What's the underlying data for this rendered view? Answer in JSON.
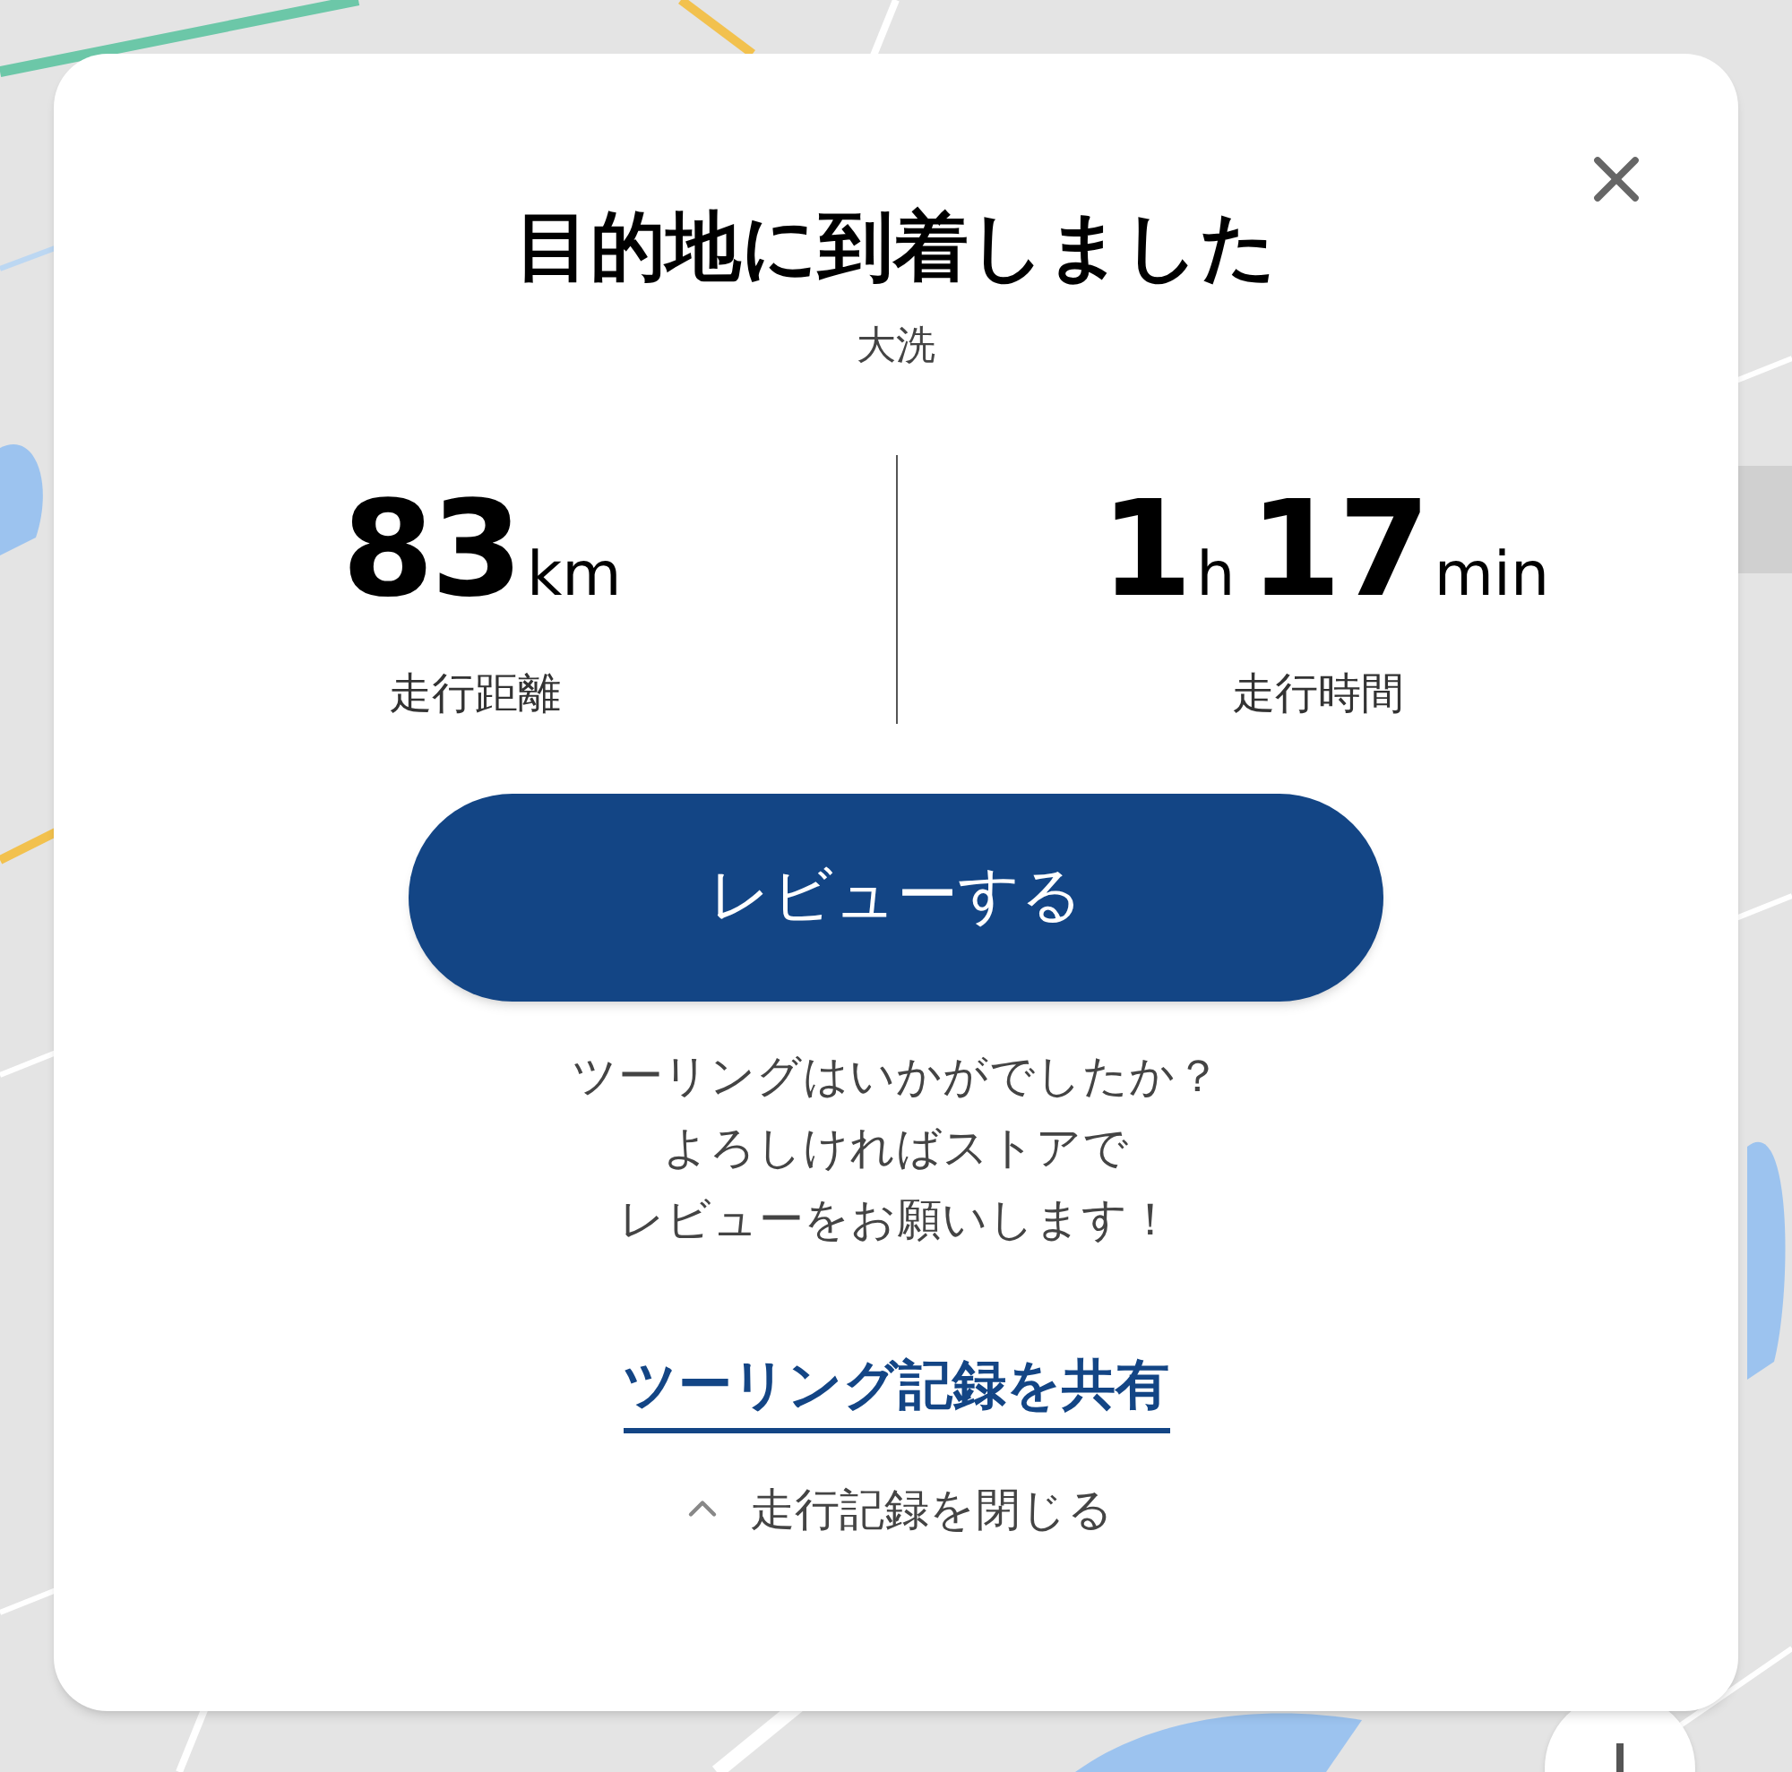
{
  "dialog": {
    "title": "目的地に到着しました",
    "destination": "大洗",
    "stats": [
      {
        "parts": [
          {
            "value": "83",
            "unit": "km"
          }
        ],
        "label": "走行距離"
      },
      {
        "parts": [
          {
            "value": "1",
            "unit": "h"
          },
          {
            "value": "17",
            "unit": "min"
          }
        ],
        "label": "走行時間"
      }
    ],
    "review_button": "レビューする",
    "message_lines": [
      "ツーリングはいかがでしたか？",
      "よろしければストアで",
      "レビューをお願いします！"
    ],
    "share_link": "ツーリング記録を共有",
    "collapse": {
      "label": "走行記録を閉じる",
      "expanded": true
    }
  }
}
